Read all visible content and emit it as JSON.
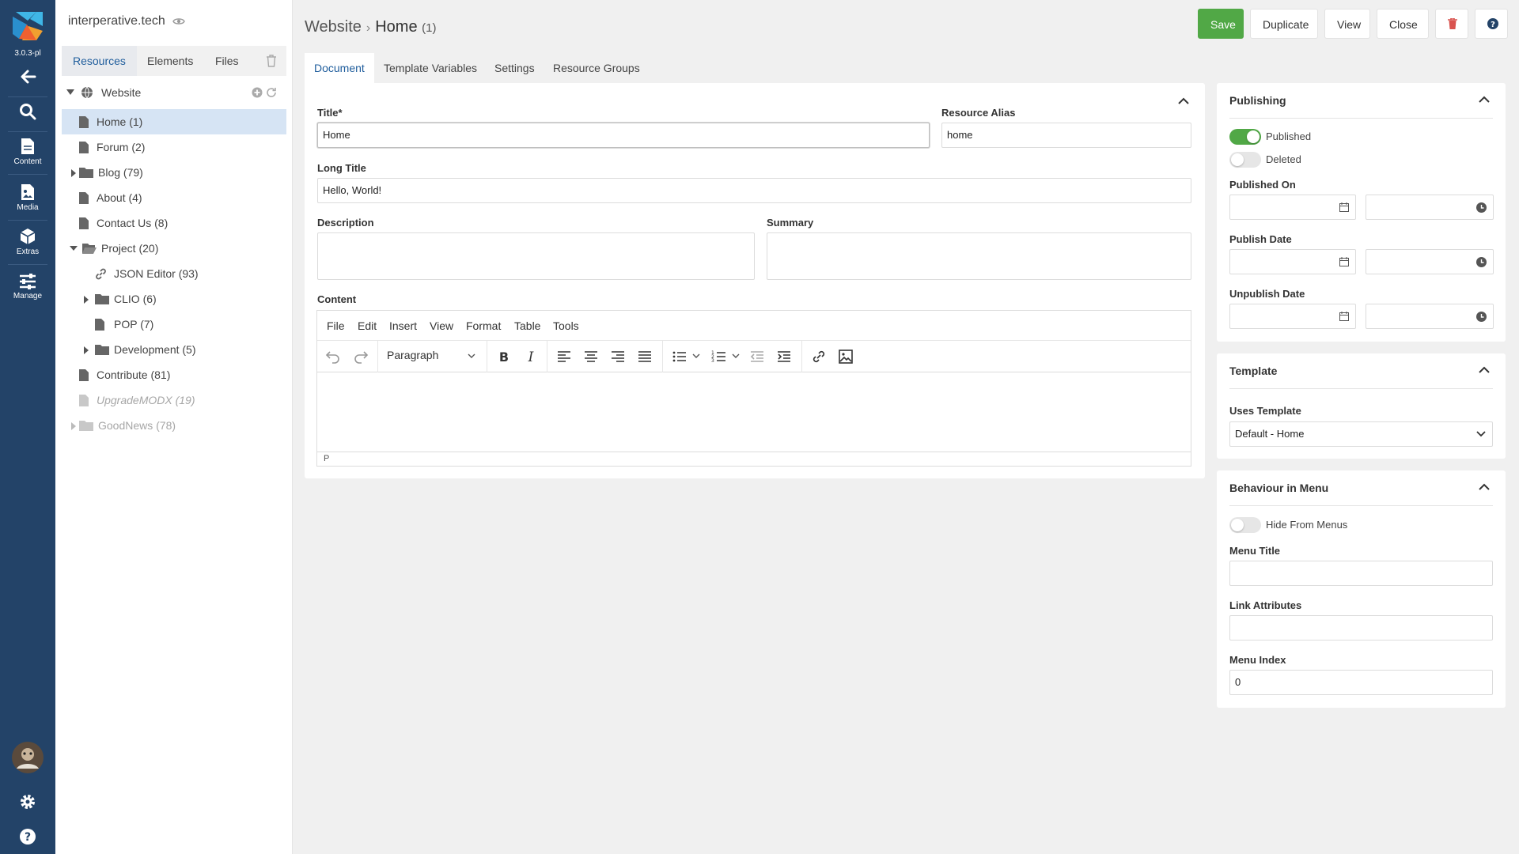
{
  "rail": {
    "version": "3.0.3-pl",
    "items": [
      {
        "label": "Content"
      },
      {
        "label": "Media"
      },
      {
        "label": "Extras"
      },
      {
        "label": "Manage"
      }
    ],
    "accent": "#234368"
  },
  "tree": {
    "site_name": "interperative.tech",
    "tabs": [
      "Resources",
      "Elements",
      "Files"
    ],
    "root_label": "Website",
    "items": [
      {
        "label": "Home (1)",
        "icon": "document-icon",
        "selected": true
      },
      {
        "label": "Forum (2)",
        "icon": "document-icon"
      },
      {
        "label": "Blog (79)",
        "icon": "folder-icon",
        "collapsed": true
      },
      {
        "label": "About (4)",
        "icon": "document-icon"
      },
      {
        "label": "Contact Us (8)",
        "icon": "document-icon"
      },
      {
        "label": "Project (20)",
        "icon": "folder-open-icon",
        "expanded": true
      },
      {
        "label": "JSON Editor (93)",
        "icon": "link-icon"
      },
      {
        "label": "CLIO (6)",
        "icon": "folder-icon",
        "collapsed": true
      },
      {
        "label": "POP (7)",
        "icon": "document-icon"
      },
      {
        "label": "Development (5)",
        "icon": "folder-icon",
        "collapsed": true
      },
      {
        "label": "Contribute (81)",
        "icon": "document-icon"
      },
      {
        "label": "UpgradeMODX (19)",
        "icon": "document-icon",
        "unpublished": true
      },
      {
        "label": "GoodNews (78)",
        "icon": "folder-icon",
        "hidden": true
      }
    ]
  },
  "header": {
    "crumb_parent": "Website",
    "crumb_current": "Home",
    "crumb_id": "(1)",
    "buttons": {
      "save": "Save",
      "duplicate": "Duplicate",
      "view": "View",
      "close": "Close"
    },
    "save_color": "#51a846"
  },
  "doc_tabs": [
    "Document",
    "Template Variables",
    "Settings",
    "Resource Groups"
  ],
  "document": {
    "title_label": "Title*",
    "title_value": "Home",
    "alias_label": "Resource Alias",
    "alias_value": "home",
    "longtitle_label": "Long Title",
    "longtitle_value": "Hello, World!",
    "description_label": "Description",
    "summary_label": "Summary",
    "content_label": "Content",
    "editor": {
      "menus": [
        "File",
        "Edit",
        "Insert",
        "View",
        "Format",
        "Table",
        "Tools"
      ],
      "block_format": "Paragraph",
      "status_path": "P"
    }
  },
  "publishing": {
    "title": "Publishing",
    "published_label": "Published",
    "published": true,
    "deleted_label": "Deleted",
    "deleted": false,
    "published_on_label": "Published On",
    "publish_date_label": "Publish Date",
    "unpublish_date_label": "Unpublish Date"
  },
  "template": {
    "title": "Template",
    "uses_label": "Uses Template",
    "value": "Default - Home"
  },
  "menu": {
    "title": "Behaviour in Menu",
    "hide_label": "Hide From Menus",
    "hide": false,
    "menu_title_label": "Menu Title",
    "menu_title_value": "",
    "link_attr_label": "Link Attributes",
    "link_attr_value": "",
    "menu_index_label": "Menu Index",
    "menu_index_value": "0"
  }
}
